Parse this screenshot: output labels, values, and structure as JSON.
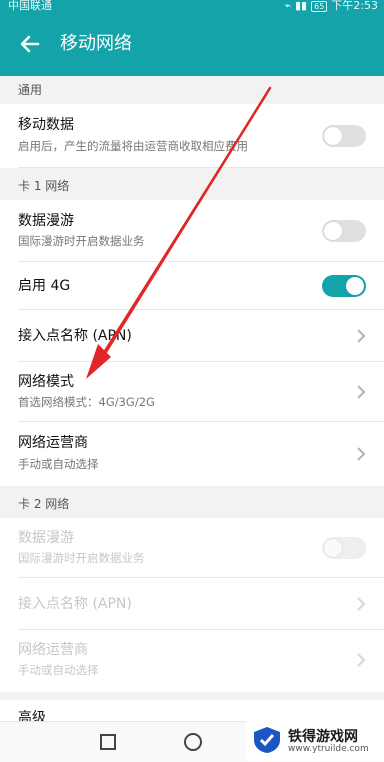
{
  "status_bar": {
    "carrier": "中国联通",
    "battery": "65",
    "time": "下午2:53"
  },
  "header": {
    "title": "移动网络",
    "back_icon": "arrow-left-icon"
  },
  "sections": {
    "general": "通用",
    "sim1": "卡 1 网络",
    "sim2": "卡 2 网络"
  },
  "items": {
    "mobile_data": {
      "title": "移动数据",
      "subtitle": "启用后，产生的流量将由运营商收取相应费用",
      "toggle_on": false
    },
    "roaming1": {
      "title": "数据漫游",
      "subtitle": "国际漫游时开启数据业务",
      "toggle_on": false
    },
    "enable4g": {
      "title": "启用 4G",
      "toggle_on": true
    },
    "apn1": {
      "title": "接入点名称 (APN)"
    },
    "network_mode": {
      "title": "网络模式",
      "subtitle": "首选网络模式：4G/3G/2G"
    },
    "operator1": {
      "title": "网络运营商",
      "subtitle": "手动或自动选择"
    },
    "roaming2": {
      "title": "数据漫游",
      "subtitle": "国际漫游时开启数据业务",
      "toggle_on": false
    },
    "apn2": {
      "title": "接入点名称 (APN)"
    },
    "operator2": {
      "title": "网络运营商",
      "subtitle": "手动或自动选择"
    },
    "advanced": {
      "title": "高级"
    }
  },
  "watermark": {
    "title": "铁得游戏网",
    "url": "www.ytruilde.com"
  },
  "colors": {
    "accent": "#13a3a8",
    "annotation_arrow": "#e02626"
  }
}
